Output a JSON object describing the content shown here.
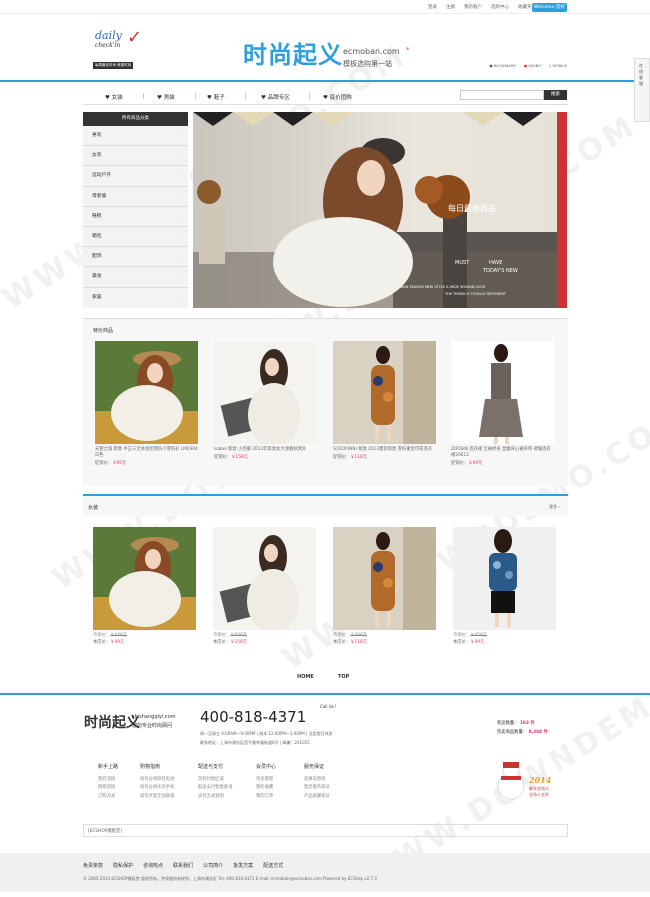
{
  "topbar": {
    "links": [
      "登录",
      "注册",
      "我的账户",
      "选购中心",
      "收藏夹",
      "报价单"
    ],
    "lang_button": "Welcome 您好"
  },
  "logo": {
    "word1": "daily",
    "word2": "check'in",
    "tagline": "每周最佳时尚·美丽时刻"
  },
  "brand": {
    "title": "时尚起义",
    "domain": "ecmoban.com",
    "slogan": "模板选购第一站"
  },
  "header_links": [
    "BOOKMARK",
    "WEIBO",
    "MOBILE"
  ],
  "side_widget": [
    "在",
    "线",
    "客",
    "服"
  ],
  "nav": [
    "女装",
    "男装",
    "鞋子",
    "品牌专区",
    "底价团购"
  ],
  "search": {
    "placeholder": "",
    "button": "搜索"
  },
  "categories": {
    "title": "所有商品分类",
    "items": [
      "男装",
      "女装",
      "运动户外",
      "母婴童",
      "鞋靴",
      "箱包",
      "配饰",
      "美妆",
      "家居"
    ]
  },
  "banner": {
    "headline": "每日最新商品",
    "tag1": "MUST",
    "tag2": "HAVE",
    "tag3": "TODAY'S NEW",
    "line1": "NEW SEASON NEW STYLE A WIDE WOMAN LOOK",
    "line2": "THE TREND IS TOTALLY DIFFERENT"
  },
  "featured": {
    "title": "特价商品",
    "items": [
      {
        "name": "天使之城 新款 半正三无休金团雪纺小雪纺衫 LM0304 白色",
        "price_label": "促销价：",
        "price": "￥99元"
      },
      {
        "name": "Isabel 新款 小西服 2013年新款女大领春秋款外",
        "price_label": "促销价：",
        "price": "￥158元"
      },
      {
        "name": "GOLDFINNI 新款 2013夏装新款 雪纺重金印花连衣",
        "price_label": "促销价：",
        "price": "￥118元"
      },
      {
        "name": "ZOOSIN 连衣裙 无袖修身 显瘦背心裙吊带 褶皱连衣裙20612",
        "price_label": "促销价：",
        "price": "￥99元"
      }
    ]
  },
  "women": {
    "title": "女装",
    "more": "更多",
    "items": [
      {
        "mkt_label": "市场价：",
        "mkt": "￥448元",
        "shop_label": "本店价：",
        "shop": "￥99元"
      },
      {
        "mkt_label": "市场价：",
        "mkt": "￥698元",
        "shop_label": "本店价：",
        "shop": "￥158元"
      },
      {
        "mkt_label": "市场价：",
        "mkt": "￥498元",
        "shop_label": "本店价：",
        "shop": "￥118元"
      },
      {
        "mkt_label": "市场价：",
        "mkt": "￥458元",
        "shop_label": "本店价：",
        "shop": "￥99元"
      }
    ]
  },
  "foot_nav": [
    "HOME",
    "TOP"
  ],
  "footer": {
    "brand": "时尚起义",
    "brand_domain": "shishangqiyi.com",
    "brand_slogan": "您的专业时尚顾问",
    "phone": "400-818-4371",
    "call_us": "Call Us !",
    "hours": "周一至周五 9:00AM～9:00PM | 周末 12:00PM～1:00PM | 法定假日休息",
    "address": "联系地址：上海市浦东区西平路幸福街道6号 | 邮编：201015",
    "stats": [
      {
        "label": "新品数量",
        "value": "183 件"
      },
      {
        "label": "热卖商品数量",
        "value": "8,384 件"
      }
    ],
    "columns": [
      {
        "title": "新手上路",
        "items": [
          "售后流程",
          "购物流程",
          "订购方式"
        ]
      },
      {
        "title": "购物指南",
        "items": [
          "如何分辨原装电池",
          "如何分辨水货手机",
          "如何享受全国联保"
        ]
      },
      {
        "title": "配送与支付",
        "items": [
          "货到付款区域",
          "配送支付智能查询",
          "支付方式说明"
        ]
      },
      {
        "title": "会员中心",
        "items": [
          "资金管理",
          "我的收藏",
          "我的订单"
        ]
      },
      {
        "title": "服务保证",
        "items": [
          "退换货原则",
          "售后服务保证",
          "产品质量保证"
        ]
      }
    ],
    "mascot": {
      "year": "2014",
      "line1": "新年全场大",
      "line2": "全场八五折"
    },
    "search_text": "[ECSHOP模板堂]",
    "bottom_links": [
      "免责条款",
      "隐私保护",
      "咨询热点",
      "联系我们",
      "公司简介",
      "批发方案",
      "配送方式"
    ],
    "copyright": "© 2005-2014 ECSHOP模板堂 版权所有，并保留所有权利。上海市浦东区 Tel: 400-818-4371 E-mail: ecmoban@ecmoban.com   Powered by ECShop v2.7.3"
  },
  "watermark": "WWW.DOWNDEMO.COM"
}
